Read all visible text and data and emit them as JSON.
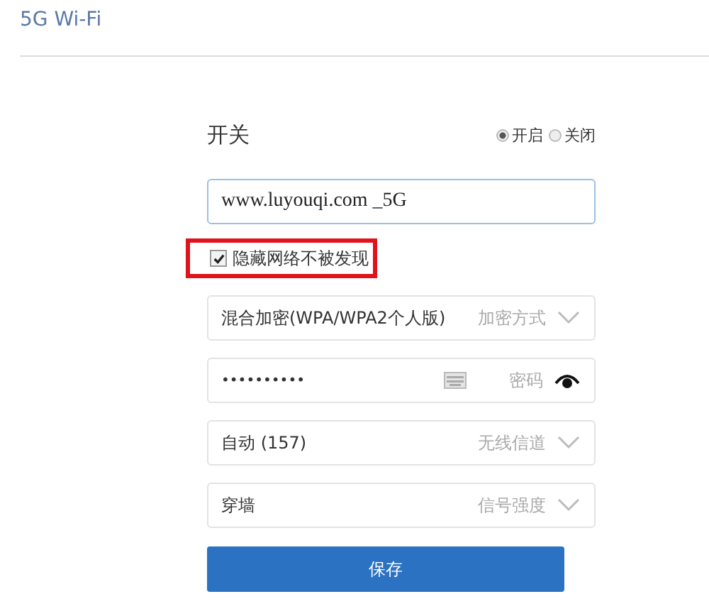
{
  "section_title": "5G Wi-Fi",
  "switch": {
    "label": "开关",
    "options": [
      {
        "label": "开启",
        "selected": true
      },
      {
        "label": "关闭",
        "selected": false
      }
    ]
  },
  "ssid": {
    "value": "www.luyouqi.com _5G"
  },
  "hide_network": {
    "label": "隐藏网络不被发现",
    "checked": true,
    "highlighted": true
  },
  "fields": [
    {
      "kind": "select",
      "value": "混合加密(WPA/WPA2个人版)",
      "label": "加密方式"
    },
    {
      "kind": "password",
      "value": "••••••••••",
      "label": "密码"
    },
    {
      "kind": "select",
      "value": "自动 (157)",
      "label": "无线信道"
    },
    {
      "kind": "select",
      "value": "穿墙",
      "label": "信号强度"
    }
  ],
  "save_button": "保存"
}
